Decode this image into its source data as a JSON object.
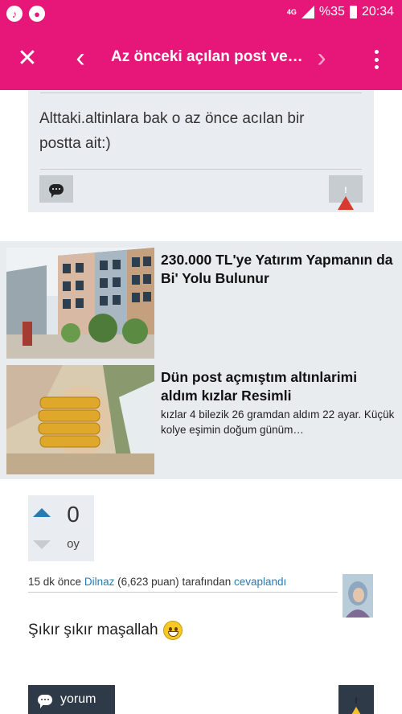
{
  "status_bar": {
    "network": "4G",
    "battery": "%35",
    "time": "20:34"
  },
  "app_bar": {
    "title": "Az önceki açılan post ve…"
  },
  "answer_card": {
    "text": "Alttaki.altinlara bak o az önce acılan bir postta ait:)"
  },
  "ads": [
    {
      "title": "230.000 TL'ye Yatırım Yapmanın da Bi' Yolu Bulunur",
      "description": ""
    },
    {
      "title": "Dün post açmıştım altınlarimi aldım kızlar Resimli",
      "description": "kızlar 4 bilezik 26 gramdan aldım 22 ayar. Küçük kolye eşimin doğum günüm…"
    }
  ],
  "post": {
    "vote_count": "0",
    "vote_label": "oy",
    "meta": {
      "time": "15 dk önce",
      "user": "Dilnaz",
      "points": "(6,623 puan)",
      "by": "tarafından",
      "action": "cevaplandı"
    },
    "text": "Şıkır şıkır maşallah",
    "comment_label": "yorum"
  },
  "colors": {
    "brand": "#e7177a",
    "link": "#2a7ab0",
    "card_bg": "#e9edf1",
    "dark_button": "#2e3a48",
    "warning_red": "#d93a2f"
  }
}
